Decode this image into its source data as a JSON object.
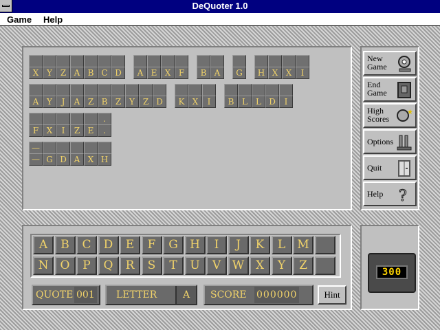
{
  "window": {
    "title": "DeQuoter 1.0"
  },
  "menu": [
    "Game",
    "Help"
  ],
  "puzzle": {
    "lines": [
      [
        [
          "X",
          "Y",
          "Z",
          "A",
          "B",
          "C",
          "D"
        ],
        [
          "A",
          "E",
          "X",
          "F"
        ],
        [
          "B",
          "A"
        ],
        [
          "G"
        ],
        [
          "H",
          "X",
          "X",
          "I"
        ]
      ],
      [
        [
          "A",
          "Y",
          "J",
          "A",
          "Z",
          "B",
          "Z",
          "Y",
          "Z",
          "D"
        ],
        [
          "K",
          "X",
          "I"
        ],
        [
          "B",
          "L",
          "L",
          "D",
          "I"
        ]
      ],
      [
        [
          "F",
          "X",
          "I",
          "Z",
          "E",
          "."
        ]
      ],
      [
        [
          "—",
          "G",
          "D",
          "A",
          "X",
          "H"
        ]
      ]
    ],
    "guesses": [
      [
        [
          "",
          "",
          "",
          "",
          "",
          "",
          ""
        ],
        [
          "",
          "",
          "",
          ""
        ],
        [
          "",
          ""
        ],
        [
          ""
        ],
        [
          "",
          "",
          "",
          ""
        ]
      ],
      [
        [
          "",
          "",
          "",
          "",
          "",
          "",
          "",
          "",
          "",
          ""
        ],
        [
          "",
          "",
          ""
        ],
        [
          "",
          "",
          "",
          "",
          ""
        ]
      ],
      [
        [
          "",
          "",
          "",
          "",
          "",
          "."
        ]
      ],
      [
        [
          "—",
          "",
          "",
          "",
          "",
          ""
        ]
      ]
    ]
  },
  "side_buttons": [
    {
      "label": "New Game",
      "icon": "new-game-icon"
    },
    {
      "label": "End Game",
      "icon": "end-game-icon"
    },
    {
      "label": "High Scores",
      "icon": "high-scores-icon"
    },
    {
      "label": "Options",
      "icon": "options-icon"
    },
    {
      "label": "Quit",
      "icon": "quit-icon"
    },
    {
      "label": "Help",
      "icon": "help-icon"
    }
  ],
  "alphabet": [
    [
      "A",
      "B",
      "C",
      "D",
      "E",
      "F",
      "G",
      "H",
      "I",
      "J",
      "K",
      "L",
      "M",
      ""
    ],
    [
      "N",
      "O",
      "P",
      "Q",
      "R",
      "S",
      "T",
      "U",
      "V",
      "W",
      "X",
      "Y",
      "Z",
      ""
    ]
  ],
  "status": {
    "quote_label": "QUOTE",
    "quote_value": "001",
    "letter_label": "LETTER",
    "letter_value": "A",
    "score_label": "SCORE",
    "score_value": "000000",
    "hint_label": "Hint"
  },
  "timer": {
    "value": "300"
  },
  "colors": {
    "titlebar": "#000080",
    "letter": "#f1d36a",
    "lcd_digits": "#ffd400"
  }
}
